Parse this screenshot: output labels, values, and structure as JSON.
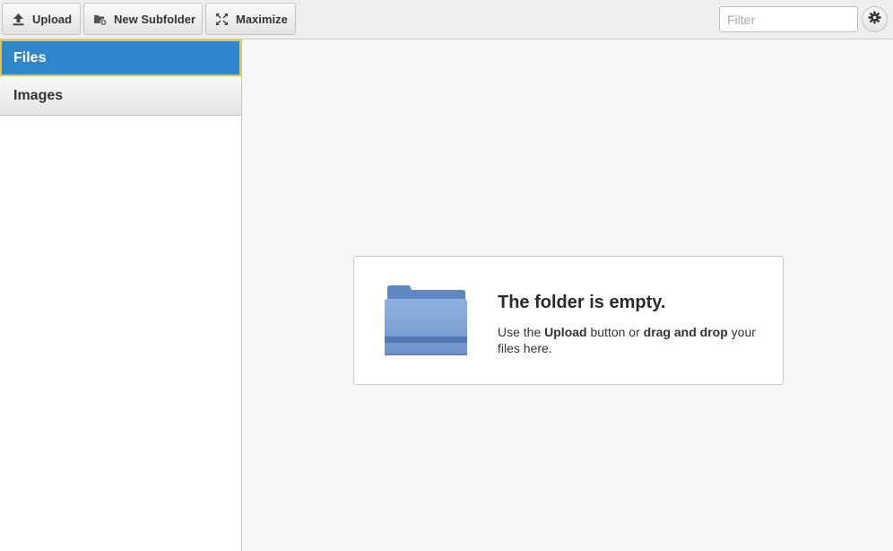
{
  "toolbar": {
    "upload_label": "Upload",
    "subfolder_label": "New Subfolder",
    "maximize_label": "Maximize",
    "filter_placeholder": "Filter",
    "filter_value": ""
  },
  "sidebar": {
    "items": [
      {
        "label": "Files",
        "selected": true
      },
      {
        "label": "Images",
        "selected": false
      }
    ]
  },
  "empty_state": {
    "title": "The folder is empty.",
    "text_1": "Use the ",
    "text_bold_1": "Upload",
    "text_2": " button or ",
    "text_bold_2": "drag and drop",
    "text_3": " your files here."
  },
  "colors": {
    "selected_bg": "#2e87cb",
    "selected_border": "#e7c346",
    "folder_blue": "#7fa3d7"
  },
  "icons": [
    "upload-icon",
    "new-folder-icon",
    "maximize-icon",
    "gear-icon",
    "folder-icon"
  ]
}
